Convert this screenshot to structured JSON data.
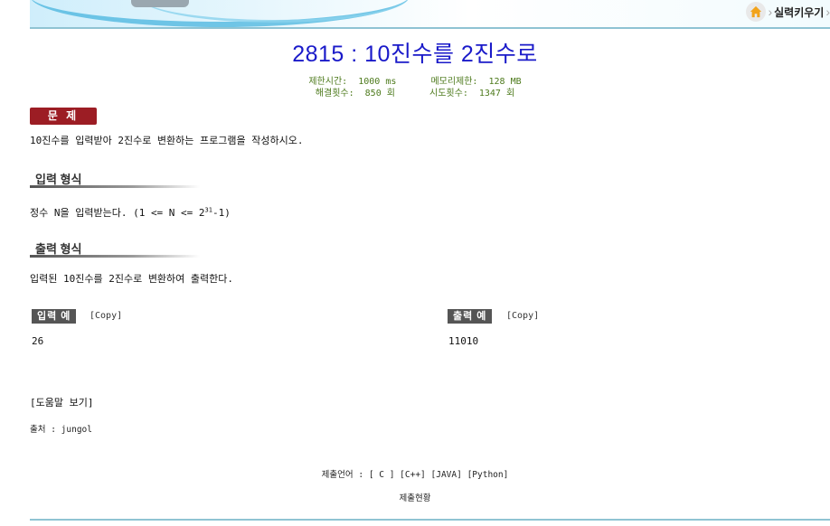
{
  "breadcrumb": {
    "current": "실력키우기"
  },
  "problem": {
    "title": "2815 : 10진수를 2진수로",
    "time_limit_label": "제한시간:",
    "time_limit": "1000 ms",
    "memory_limit_label": "메모리제한:",
    "memory_limit": "128 MB",
    "solved_label": "해결횟수:",
    "solved": "850 회",
    "tries_label": "시도횟수:",
    "tries": "1347 회"
  },
  "sections": {
    "problem_badge": "문 제",
    "problem_text": "10진수를 입력받아 2진수로 변환하는 프로그램을 작성하시오.",
    "input_heading": "입력 형식",
    "input_text_pre": "정수 N을 입력받는다. (1 <= N <= 2",
    "input_text_sup": "31",
    "input_text_post": "-1)",
    "output_heading": "출력 형식",
    "output_text": "입력된 10진수를 2진수로 변환하여 출력한다."
  },
  "examples": {
    "input_label": "입력 예",
    "input_copy": "[Copy]",
    "input_value": "26",
    "output_label": "출력 예",
    "output_copy": "[Copy]",
    "output_value": "11010"
  },
  "footer": {
    "help_link": "[도움말 보기]",
    "source_label": "출처 :",
    "source": "jungol",
    "submit_lang_label": "제출언어 :",
    "lang_c": "[ C ]",
    "lang_cpp": "[C++]",
    "lang_java": "[JAVA]",
    "lang_python": "[Python]",
    "submit_status": "제출현황"
  }
}
